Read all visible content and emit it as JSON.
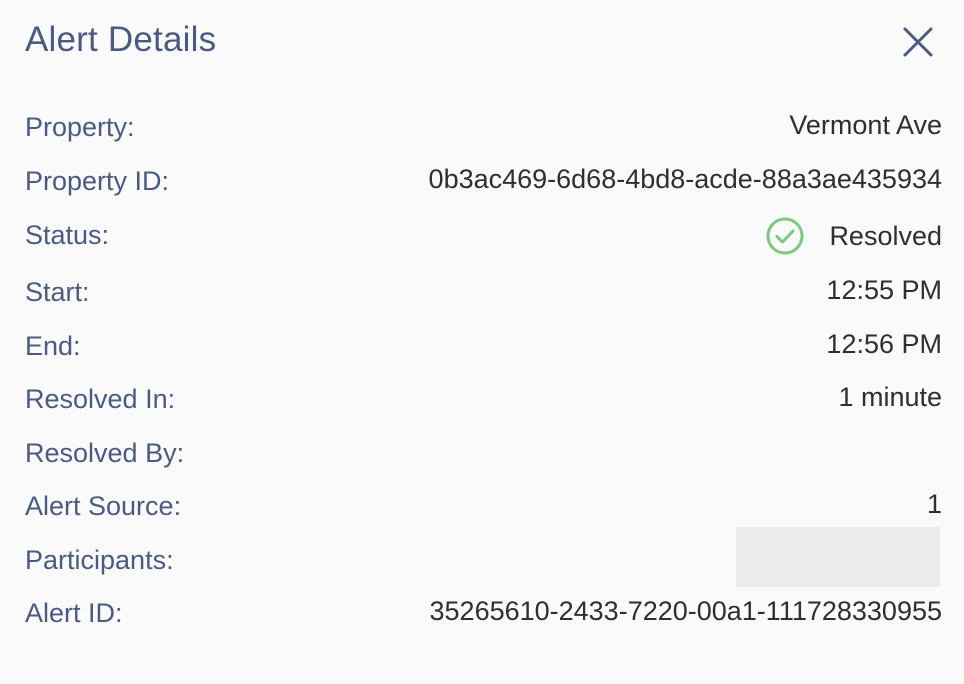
{
  "header": {
    "title": "Alert Details",
    "close_icon": "close-icon"
  },
  "details": {
    "property_label": "Property:",
    "property_value": "Vermont Ave",
    "property_id_label": "Property ID:",
    "property_id_value": "0b3ac469-6d68-4bd8-acde-88a3ae435934",
    "status_label": "Status:",
    "status_icon": "check-circle-icon",
    "status_value": "Resolved",
    "start_label": "Start:",
    "start_value": "12:55 PM",
    "end_label": "End:",
    "end_value": "12:56 PM",
    "resolved_in_label": "Resolved In:",
    "resolved_in_value": "1 minute",
    "resolved_by_label": "Resolved By:",
    "resolved_by_value": "",
    "alert_source_label": "Alert Source:",
    "alert_source_value": "1",
    "participants_label": "Participants:",
    "participants_value": "",
    "alert_id_label": "Alert ID:",
    "alert_id_value": "35265610-2433-7220-00a1-111728330955"
  },
  "colors": {
    "label": "#4a5a85",
    "value": "#2f2f33",
    "status_ok": "#7cc97c",
    "background": "#fafafb",
    "redaction": "#ebebeb"
  }
}
